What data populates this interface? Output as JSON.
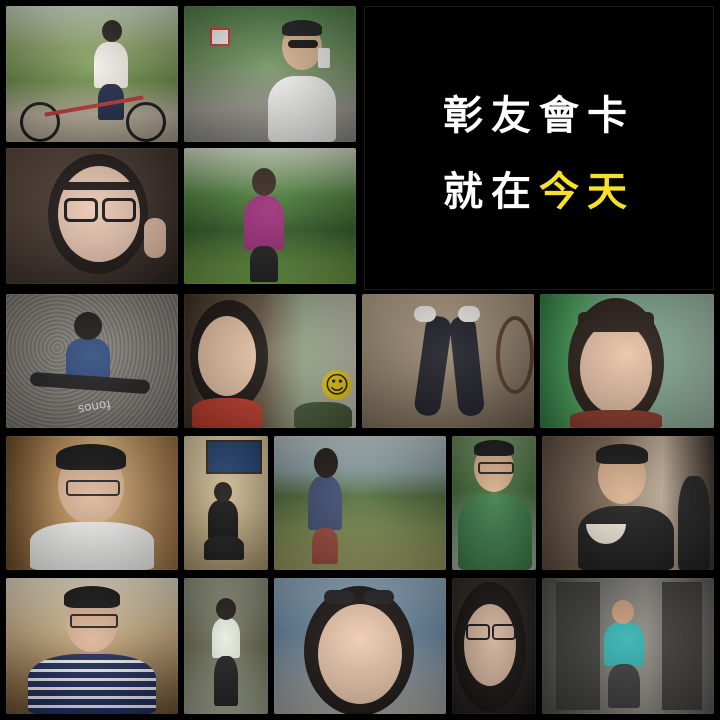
{
  "title": {
    "line1": "彰友會卡",
    "line2_prefix": "就在",
    "line2_highlight": "今天",
    "text_color": "#ffffff",
    "highlight_color": "#f5e12b"
  },
  "photos": [
    {
      "name": "photo-girl-on-bicycle",
      "palette": [
        "#6f8f4a",
        "#cfc7b8"
      ]
    },
    {
      "name": "photo-boy-with-phone-sunglasses",
      "palette": [
        "#3f6b3a",
        "#9a9a8e"
      ]
    },
    {
      "name": "photo-girl-glasses-closeup",
      "palette": [
        "#4a3a32",
        "#e6c3ae"
      ]
    },
    {
      "name": "photo-girl-purple-hoodie-park",
      "palette": [
        "#3e6a30",
        "#b9c7a0"
      ]
    },
    {
      "name": "photo-girl-sitting-on-gravel",
      "palette": [
        "#7d7a76",
        "#b1ada8"
      ]
    },
    {
      "name": "photo-girl-smiling-with-smiley-friend",
      "palette": [
        "#5c4f3b",
        "#e4c3a3"
      ]
    },
    {
      "name": "photo-feet-in-socks",
      "palette": [
        "#8c7b66",
        "#c7b59d"
      ]
    },
    {
      "name": "photo-girl-smiling-by-fence",
      "palette": [
        "#3f8a4a",
        "#d6b49c"
      ]
    },
    {
      "name": "photo-boy-glasses-white-shirt",
      "palette": [
        "#8a6438",
        "#c99d68"
      ]
    },
    {
      "name": "photo-girl-sitting-on-steps",
      "palette": [
        "#c9b48a",
        "#2b2b2b"
      ]
    },
    {
      "name": "photo-girl-walking-grass-sea",
      "palette": [
        "#6c7c4b",
        "#9fb0b3"
      ]
    },
    {
      "name": "photo-boy-green-polo",
      "palette": [
        "#3d6b3a",
        "#a6b2a2"
      ]
    },
    {
      "name": "photo-boy-eating-from-bowl",
      "palette": [
        "#5a4a3c",
        "#c8b09a"
      ]
    },
    {
      "name": "photo-boy-striped-shirt-peace-sign",
      "palette": [
        "#7d5c3a",
        "#d7c6a8"
      ]
    },
    {
      "name": "photo-girl-on-rocky-path",
      "palette": [
        "#6b6a4e",
        "#9da18d"
      ]
    },
    {
      "name": "photo-girl-sunglasses-on-head-beach",
      "palette": [
        "#5f7f99",
        "#d9b9a0"
      ]
    },
    {
      "name": "photo-girl-glasses-dark-portrait",
      "palette": [
        "#1f1c1a",
        "#c8a892"
      ]
    },
    {
      "name": "photo-boy-by-stone-pillar",
      "palette": [
        "#5a5a55",
        "#8f8d86"
      ]
    }
  ],
  "ground_text": "fonos",
  "smiley_glyph": "☺"
}
